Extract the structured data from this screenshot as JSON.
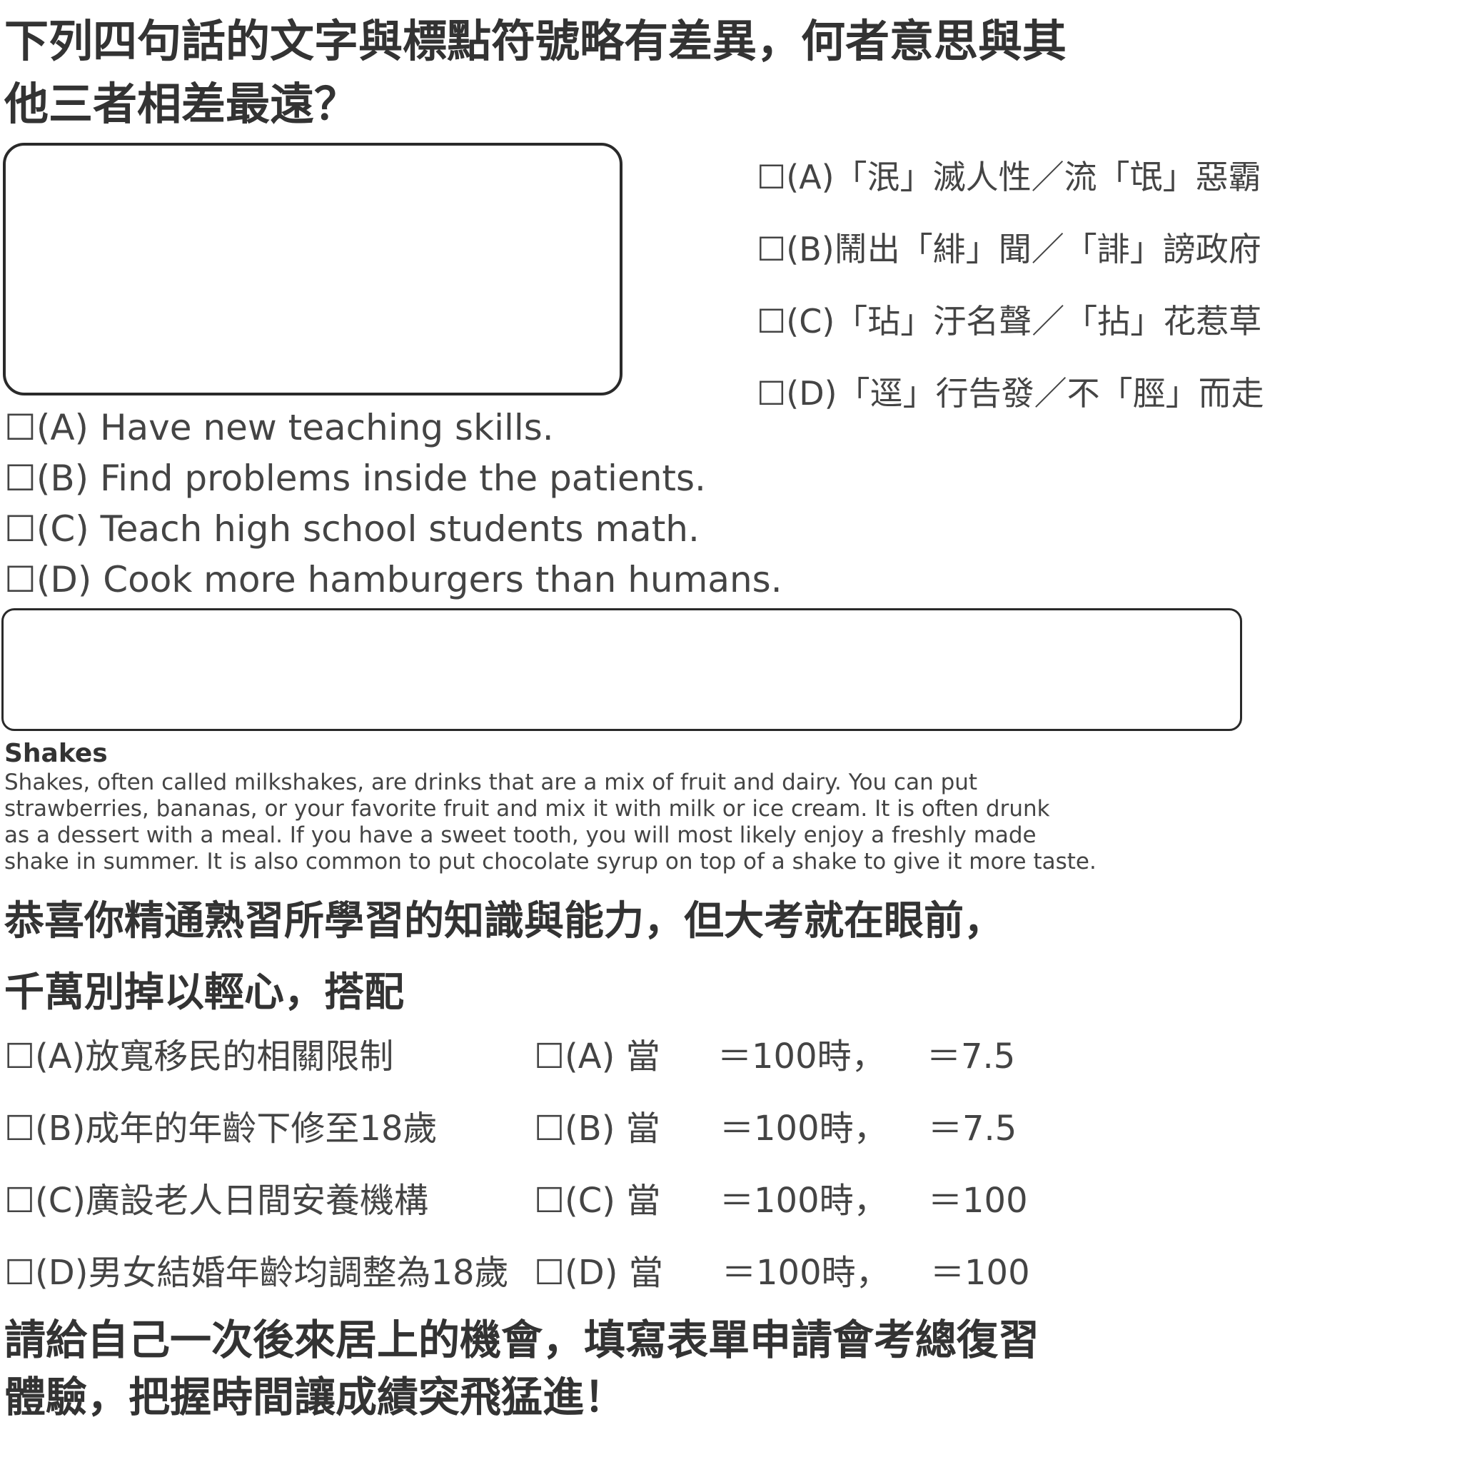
{
  "question_title": {
    "line1": "下列四句話的文字與標點符號略有差異，何者意思與其",
    "line2": "他三者相差最遠？"
  },
  "checkbox_glyph": "☐",
  "chinese_options": [
    "(A)「泯」滅人性／流「氓」惡霸",
    "(B)鬧出「緋」聞／「誹」謗政府",
    "(C)「玷」汙名聲／「拈」花惹草",
    "(D)「逕」行告發／不「脛」而走"
  ],
  "english_options": [
    "(A) Have new teaching skills.",
    "(B) Find problems inside the patients.",
    "(C) Teach high school students math.",
    "(D) Cook more hamburgers than humans."
  ],
  "shakes": {
    "heading": "Shakes",
    "lines": [
      "Shakes, often called milkshakes, are drinks that are a mix of fruit and dairy.  You can put",
      "strawberries, bananas, or your favorite fruit and mix it with milk or ice cream.  It is often drunk",
      "as a dessert with a meal.  If you have a sweet  tooth, you will most likely enjoy a freshly made",
      "shake in summer.  It is also common to put chocolate syrup on top of a shake to give it more taste."
    ]
  },
  "congrats": {
    "line1": "恭喜你精通熟習所學習的知識與能力，但大考就在眼前，",
    "line2": "千萬別掉以輕心，搭配"
  },
  "policy_options": [
    "(A)放寬移民的相關限制",
    "(B)成年的年齡下修至18歲",
    "(C)廣設老人日間安養機構",
    "(D)男女結婚年齡均調整為18歲"
  ],
  "math_options": [
    {
      "label": "(A) 當",
      "mid": "＝100時，",
      "end": "＝7.5"
    },
    {
      "label": "(B) 當",
      "mid": "＝100時，",
      "end": "＝7.5"
    },
    {
      "label": "(C) 當",
      "mid": "＝100時，",
      "end": "＝100"
    },
    {
      "label": "(D) 當",
      "mid": "＝100時，",
      "end": "＝100"
    }
  ],
  "closing": {
    "line1": "請給自己一次後來居上的機會，填寫表單申請會考總復習",
    "line2": "體驗，把握時間讓成績突飛猛進！"
  }
}
